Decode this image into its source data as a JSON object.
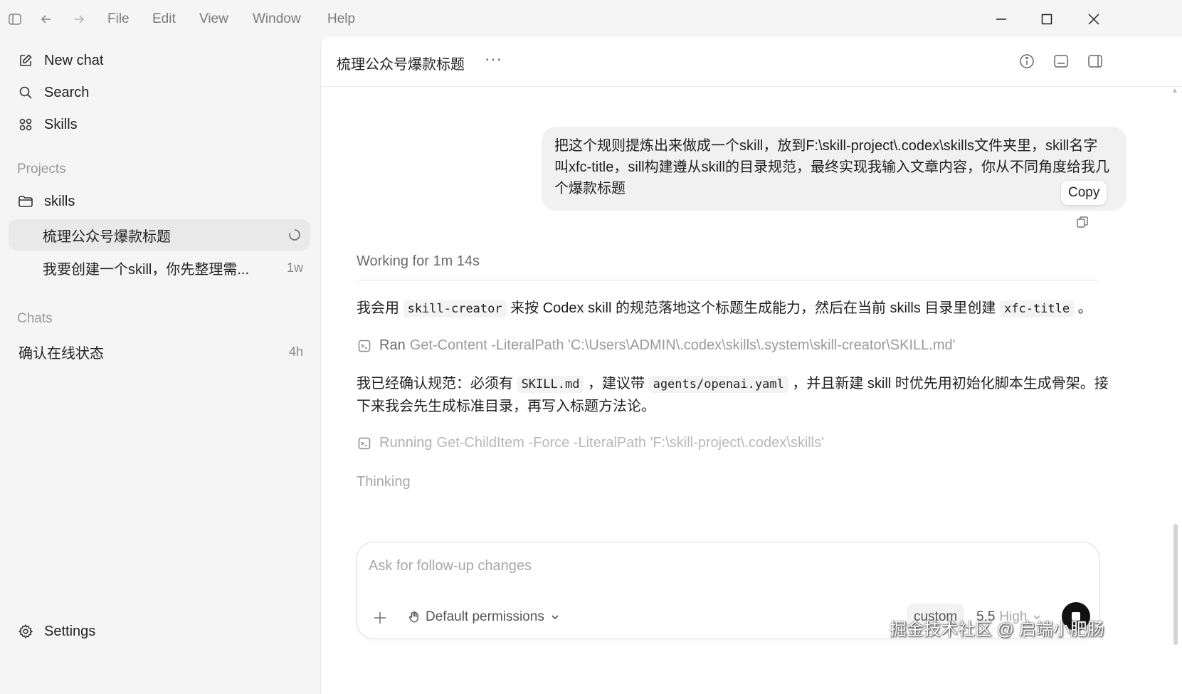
{
  "menu": {
    "items": [
      "File",
      "Edit",
      "View",
      "Window",
      "Help"
    ]
  },
  "sidebar": {
    "new_chat": "New chat",
    "search": "Search",
    "skills": "Skills",
    "projects_label": "Projects",
    "project_name": "skills",
    "threads": [
      {
        "title": "梳理公众号爆款标题",
        "meta": ""
      },
      {
        "title": "我要创建一个skill，你先整理需...",
        "meta": "1w"
      }
    ],
    "chats_label": "Chats",
    "chats": [
      {
        "title": "确认在线状态",
        "meta": "4h"
      }
    ],
    "settings": "Settings"
  },
  "header": {
    "title": "梳理公众号爆款标题",
    "more": "···"
  },
  "conversation": {
    "user_message": "把这个规则提炼出来做成一个skill，放到F:\\skill-project\\.codex\\skills文件夹里，skill名字叫xfc-title，sill构建遵从skill的目录规范，最终实现我输入文章内容，你从不同角度给我几个爆款标题",
    "copy_label": "Copy",
    "working_label": "Working for 1m 14s",
    "para1": {
      "t1": "我会用 ",
      "c1": "skill-creator",
      "t2": " 来按 Codex skill 的规范落地这个标题生成能力，然后在当前 skills 目录里创建 ",
      "c2": "xfc-title",
      "t3": " 。"
    },
    "cmd1": {
      "verb": "Ran",
      "text": "Get-Content -LiteralPath 'C:\\Users\\ADMIN\\.codex\\skills\\.system\\skill-creator\\SKILL.md'"
    },
    "para2": {
      "t1": "我已经确认规范：必须有 ",
      "c1": "SKILL.md",
      "t2": " ，建议带 ",
      "c2": "agents/openai.yaml",
      "t3": " ，并且新建 skill 时优先用初始化脚本生成骨架。接下来我会先生成标准目录，再写入标题方法论。"
    },
    "cmd2": {
      "verb": "Running",
      "text": "Get-ChildItem -Force -LiteralPath 'F:\\skill-project\\.codex\\skills'"
    },
    "thinking": "Thinking"
  },
  "composer": {
    "placeholder": "Ask for follow-up changes",
    "permissions": "Default permissions",
    "custom": "custom",
    "model": "5.5",
    "effort": "High"
  },
  "watermark": "掘金技术社区 @ 启端小肥肠"
}
